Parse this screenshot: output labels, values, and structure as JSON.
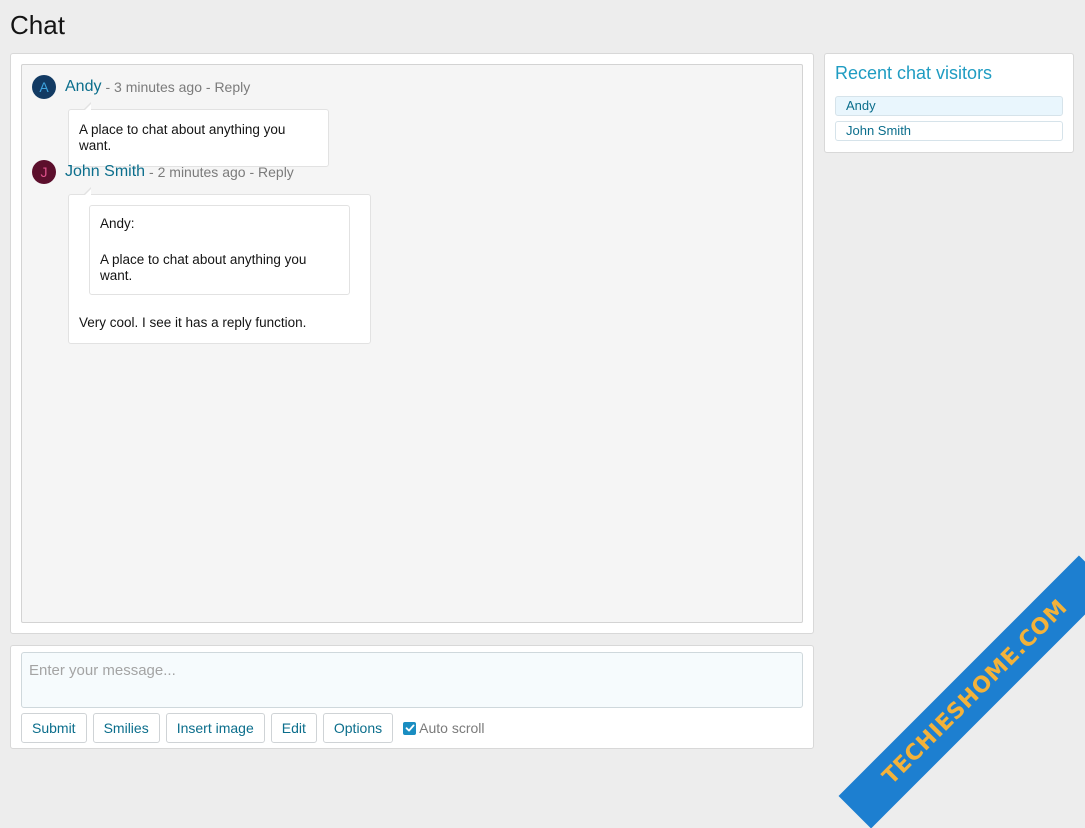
{
  "page": {
    "title": "Chat"
  },
  "messages": [
    {
      "author": "Andy",
      "initial": "A",
      "avatar_bg": "#123a63",
      "avatar_fg": "#3ea4e0",
      "time": "3 minutes ago",
      "reply_label": "Reply",
      "text": "A place to chat about anything you want."
    },
    {
      "author": "John Smith",
      "initial": "J",
      "avatar_bg": "#5c0f2c",
      "avatar_fg": "#e0528b",
      "time": "2 minutes ago",
      "reply_label": "Reply",
      "quote_author": "Andy:",
      "quote_text": "A place to chat about anything you want.",
      "text": "Very cool. I see it has a reply function."
    }
  ],
  "input": {
    "placeholder": "Enter your message..."
  },
  "toolbar": {
    "submit": "Submit",
    "smilies": "Smilies",
    "insert_image": "Insert image",
    "edit": "Edit",
    "options": "Options",
    "auto_scroll": "Auto scroll",
    "auto_scroll_checked": true
  },
  "sidebar": {
    "title": "Recent chat visitors",
    "visitors": [
      {
        "name": "Andy",
        "active": true
      },
      {
        "name": "John Smith",
        "active": false
      }
    ]
  },
  "watermark": {
    "text": "TECHIESHOME.COM"
  },
  "colors": {
    "accent": "#0b6e8c",
    "sidebar_title": "#1f9cc2",
    "active_visitor_bg": "#e9f6fd",
    "checkbox": "#1a8dc1",
    "watermark_bg": "#1d7fd0",
    "watermark_text": "#f3b23a"
  },
  "icons": {
    "checkbox": "checkmark-icon"
  }
}
